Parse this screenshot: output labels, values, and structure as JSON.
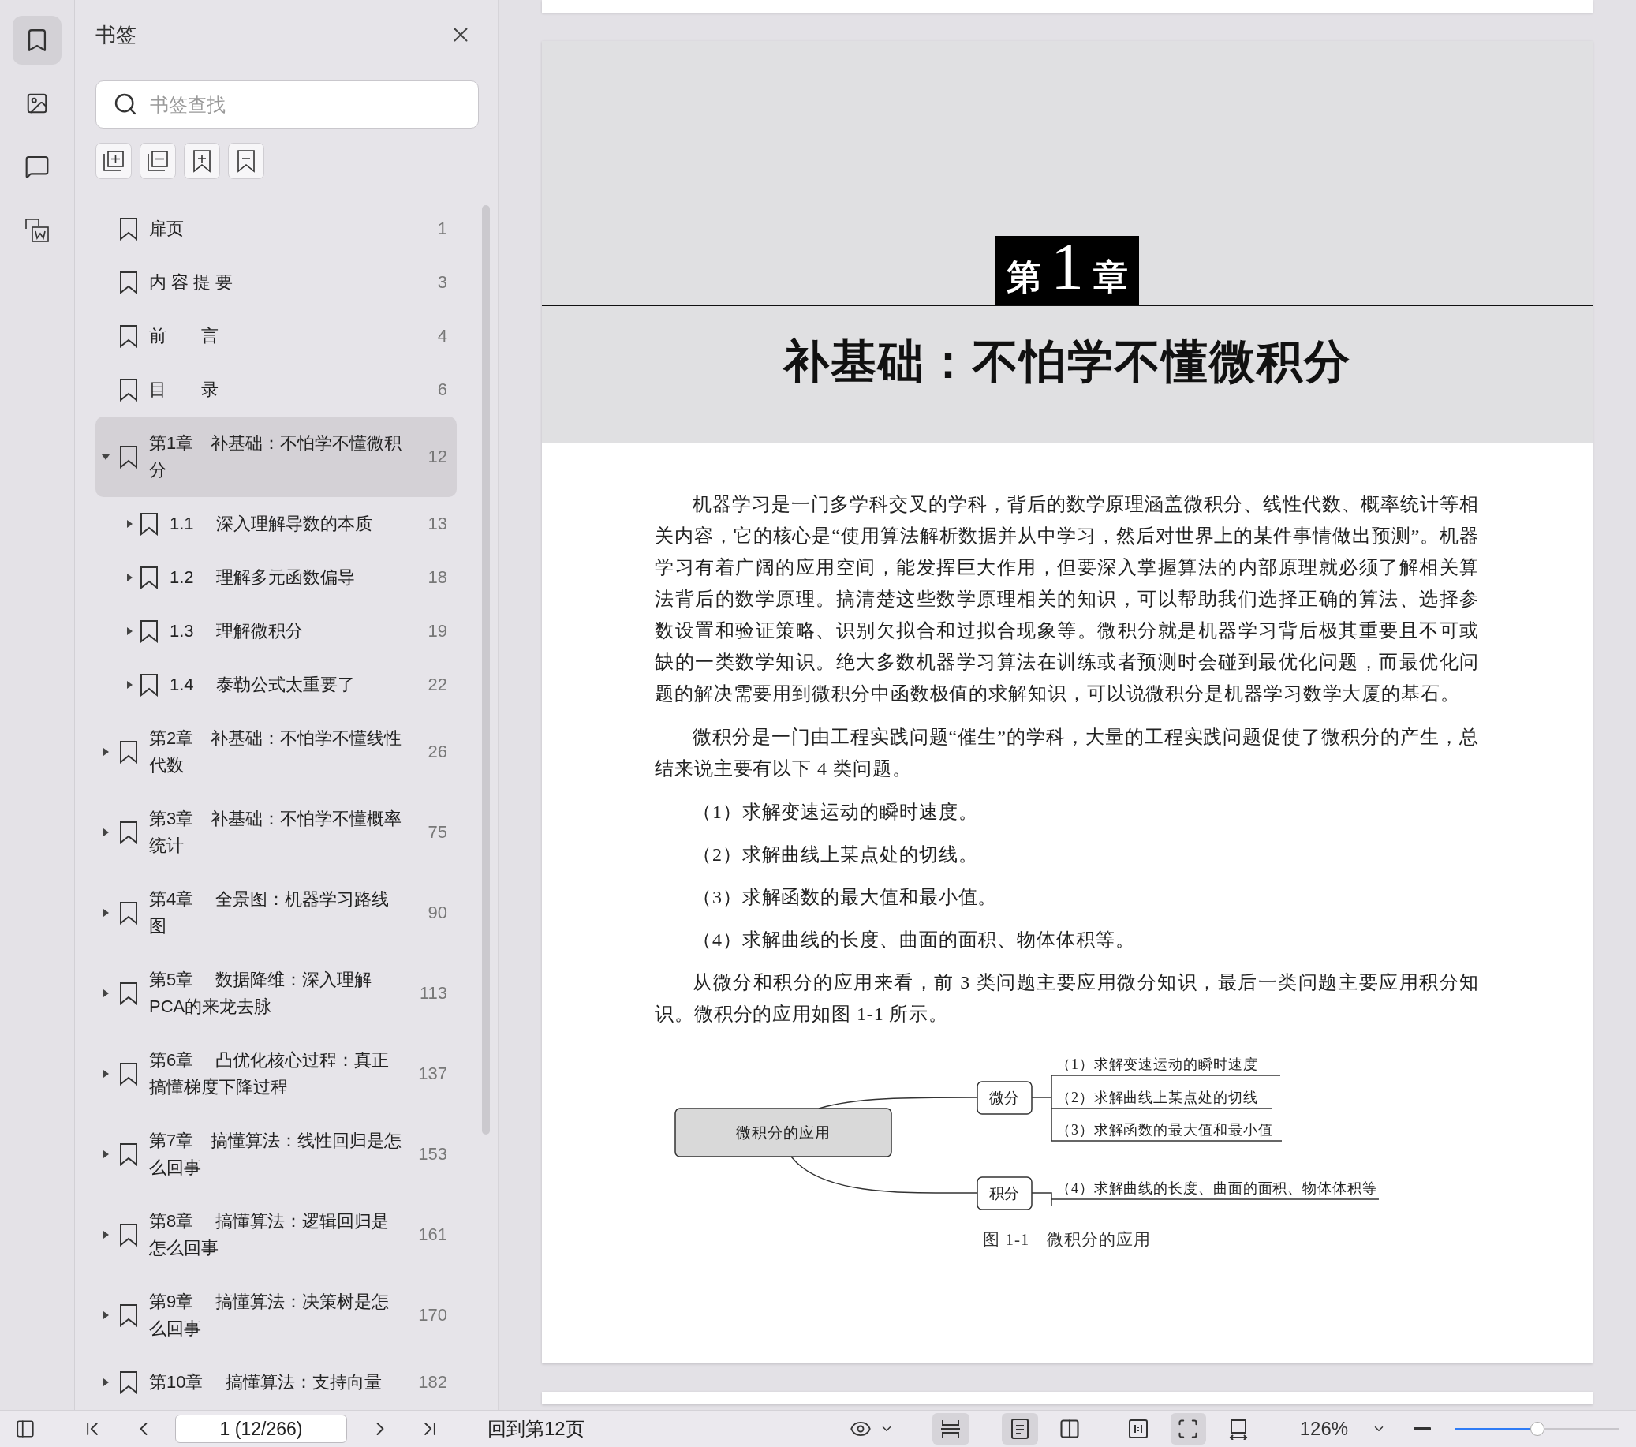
{
  "rail": [
    {
      "kind": "bookmarks",
      "selected": true
    },
    {
      "kind": "images",
      "selected": false
    },
    {
      "kind": "comments",
      "selected": false
    },
    {
      "kind": "convert",
      "selected": false
    }
  ],
  "panel": {
    "title": "书签",
    "search": {
      "placeholder": "书签查找"
    },
    "bookmarks": [
      {
        "title": "扉页",
        "page": "1",
        "selected": false
      },
      {
        "title": "内 容 提 要",
        "page": "3",
        "selected": false
      },
      {
        "title": "前　　言",
        "page": "4",
        "selected": false
      },
      {
        "title": "目　　录",
        "page": "6",
        "selected": false
      },
      {
        "title": "第1章　补基础：不怕学不懂微积分",
        "page": "12",
        "expanded": true,
        "selected": true,
        "children": [
          {
            "title": "1.1　 深入理解导数的本质",
            "page": "13",
            "expanded": false,
            "selected": false
          },
          {
            "title": "1.2　 理解多元函数偏导",
            "page": "18",
            "expanded": false,
            "selected": false
          },
          {
            "title": "1.3　 理解微积分",
            "page": "19",
            "expanded": false,
            "selected": false
          },
          {
            "title": "1.4　 泰勒公式太重要了",
            "page": "22",
            "expanded": false,
            "selected": false
          }
        ]
      },
      {
        "title": "第2章　补基础：不怕学不懂线性代数",
        "page": "26",
        "expanded": false,
        "selected": false
      },
      {
        "title": "第3章　补基础：不怕学不懂概率统计",
        "page": "75",
        "expanded": false,
        "selected": false
      },
      {
        "title": "第4章　 全景图：机器学习路线图",
        "page": "90",
        "expanded": false,
        "selected": false
      },
      {
        "title": "第5章　 数据降维：深入理解PCA的来龙去脉",
        "page": "113",
        "expanded": false,
        "selected": false
      },
      {
        "title": "第6章　 凸优化核心过程：真正搞懂梯度下降过程",
        "page": "137",
        "expanded": false,
        "selected": false
      },
      {
        "title": "第7章　搞懂算法：线性回归是怎么回事",
        "page": "153",
        "expanded": false,
        "selected": false
      },
      {
        "title": "第8章　 搞懂算法：逻辑回归是怎么回事",
        "page": "161",
        "expanded": false,
        "selected": false
      },
      {
        "title": "第9章　 搞懂算法：决策树是怎么回事",
        "page": "170",
        "expanded": false,
        "selected": false
      },
      {
        "title": "第10章　 搞懂算法：支持向量",
        "page": "182",
        "expanded": false,
        "selected": false
      }
    ]
  },
  "document": {
    "chapter": {
      "prefix": "第",
      "number": "1",
      "suffix": "章"
    },
    "title": "补基础：不怕学不懂微积分",
    "blocks": [
      {
        "kind": "paragraph",
        "text": "机器学习是一门多学科交叉的学科，背后的数学原理涵盖微积分、线性代数、概率统计等相关内容，它的核心是“使用算法解析数据并从中学习，然后对世界上的某件事情做出预测”。机器学习有着广阔的应用空间，能发挥巨大作用，但要深入掌握算法的内部原理就必须了解相关算法背后的数学原理。搞清楚这些数学原理相关的知识，可以帮助我们选择正确的算法、选择参数设置和验证策略、识别欠拟合和过拟合现象等。微积分就是机器学习背后极其重要且不可或缺的一类数学知识。绝大多数机器学习算法在训练或者预测时会碰到最优化问题，而最优化问题的解决需要用到微积分中函数极值的求解知识，可以说微积分是机器学习数学大厦的基石。"
      },
      {
        "kind": "paragraph",
        "text": "微积分是一门由工程实践问题“催生”的学科，大量的工程实践问题促使了微积分的产生，总结来说主要有以下 4 类问题。"
      },
      {
        "kind": "item",
        "text": "（1）求解变速运动的瞬时速度。"
      },
      {
        "kind": "item",
        "text": "（2）求解曲线上某点处的切线。"
      },
      {
        "kind": "item",
        "text": "（3）求解函数的最大值和最小值。"
      },
      {
        "kind": "item",
        "text": "（4）求解曲线的长度、曲面的面积、物体体积等。"
      },
      {
        "kind": "paragraph",
        "text": "从微分和积分的应用来看，前 3 类问题主要应用微分知识，最后一类问题主要应用积分知识。微积分的应用如图 1-1 所示。"
      }
    ],
    "figure": {
      "root": "微积分的应用",
      "branches": [
        {
          "label": "微分",
          "leaves": [
            "（1）求解变速运动的瞬时速度",
            "（2）求解曲线上某点处的切线",
            "（3）求解函数的最大值和最小值"
          ]
        },
        {
          "label": "积分",
          "leaves": [
            "（4）求解曲线的长度、曲面的面积、物体体积等"
          ]
        }
      ],
      "caption": "图 1-1　微积分的应用"
    }
  },
  "status_bar": {
    "page_field": "1 (12/266)",
    "back_link": "回到第12页",
    "view_buttons": [
      {
        "kind": "scroll",
        "selected": true
      },
      {
        "kind": "single",
        "selected": true
      },
      {
        "kind": "double",
        "selected": false
      },
      {
        "kind": "actual",
        "selected": false
      },
      {
        "kind": "fit",
        "selected": true
      },
      {
        "kind": "rotate",
        "selected": false
      }
    ],
    "zoom": "126%",
    "zoom_slider": {
      "level": 0.5
    }
  }
}
